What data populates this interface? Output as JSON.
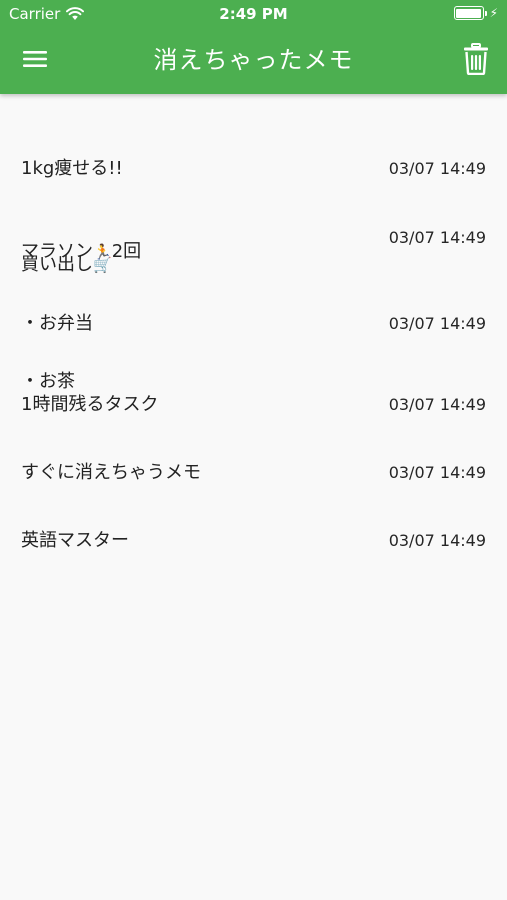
{
  "status_bar": {
    "carrier": "Carrier",
    "time": "2:49 PM",
    "icons": [
      "wifi-icon",
      "battery-icon",
      "charging-bolt-icon"
    ]
  },
  "app_bar": {
    "title": "消えちゃったメモ",
    "background_color": "#4caf50",
    "left_icon": "menu-icon",
    "right_icon": "trash-icon"
  },
  "memos": [
    {
      "text": "1kg痩せる!!",
      "date": "03/07 14:49"
    },
    {
      "text_before": "マラソン",
      "emoji": "🏃",
      "text_after": "2回",
      "date": "03/07 14:49"
    },
    {
      "title": "買い出し",
      "emoji": "🛒",
      "lines": [
        "・お弁当",
        "・お茶"
      ],
      "date": "03/07 14:49"
    },
    {
      "text": "1時間残るタスク",
      "date": "03/07 14:49"
    },
    {
      "text": "すぐに消えちゃうメモ",
      "date": "03/07 14:49"
    },
    {
      "text": "英語マスター",
      "date": "03/07 14:49"
    }
  ]
}
